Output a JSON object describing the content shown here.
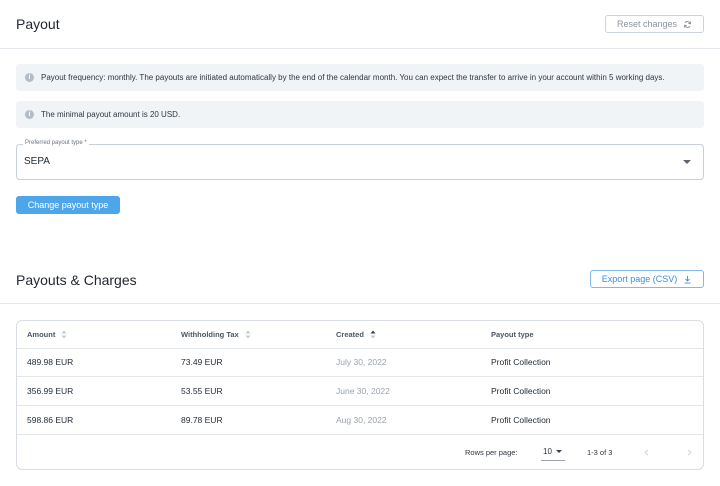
{
  "payout": {
    "title": "Payout",
    "reset_button": "Reset changes",
    "info_frequency": "Payout frequency: monthly. The payouts are initiated automatically by the end of the calendar month. You can expect the transfer to arrive in your account within 5 working days.",
    "info_minimum": "The minimal payout amount is 20 USD.",
    "payout_type_label": "Preferred payout type *",
    "payout_type_value": "SEPA",
    "change_button": "Change payout type"
  },
  "charges": {
    "title": "Payouts & Charges",
    "export_button": "Export page (CSV)",
    "columns": [
      "Amount",
      "Withholding Tax",
      "Created",
      "Payout type"
    ],
    "rows": [
      {
        "amount": "489.98 EUR",
        "tax": "73.49 EUR",
        "created": "July 30, 2022",
        "type": "Profit Collection"
      },
      {
        "amount": "356.99 EUR",
        "tax": "53.55 EUR",
        "created": "June 30, 2022",
        "type": "Profit Collection"
      },
      {
        "amount": "598.86 EUR",
        "tax": "89.78 EUR",
        "created": "Aug 30, 2022",
        "type": "Profit Collection"
      }
    ],
    "rows_per_page_label": "Rows per page:",
    "rows_per_page_value": "10",
    "range_label": "1-3 of 3"
  },
  "icons": {
    "info": "info-icon",
    "reset": "refresh-icon",
    "export": "download-icon",
    "sort": "sort-icon",
    "sort_active": "sort-active-icon",
    "prev": "chevron-left-icon",
    "next": "chevron-right-icon"
  },
  "colors": {
    "primary": "#4ea6ea",
    "accent_outline": "#7fb8ea",
    "info_background": "#f1f4f7"
  }
}
